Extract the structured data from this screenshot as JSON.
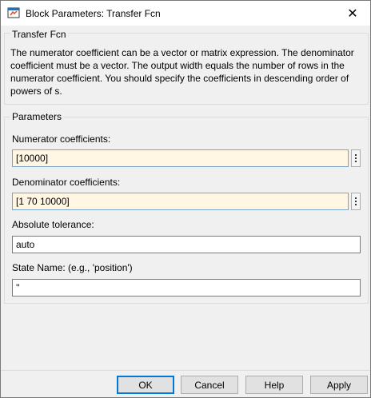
{
  "window": {
    "title": "Block Parameters: Transfer Fcn",
    "close_symbol": "✕",
    "app_icon": "simulink-icon"
  },
  "block_group": {
    "title": "Transfer Fcn",
    "description": "The numerator coefficient can be a vector or matrix expression. The denominator coefficient must be a vector. The output width equals the number of rows in the numerator coefficient. You should specify the coefficients in descending order of powers of s."
  },
  "parameters_group": {
    "title": "Parameters",
    "numerator": {
      "label": "Numerator coefficients:",
      "value": "[10000]"
    },
    "denominator": {
      "label": "Denominator coefficients:",
      "value": "[1 70 10000]"
    },
    "abs_tol": {
      "label": "Absolute tolerance:",
      "value": "auto"
    },
    "state_name": {
      "label": "State Name: (e.g., 'position')",
      "value": "''"
    }
  },
  "buttons": {
    "ok": "OK",
    "cancel": "Cancel",
    "help": "Help",
    "apply": "Apply"
  },
  "colors": {
    "editable_field_bg": "#fff7e4",
    "default_button_border": "#0078d7"
  }
}
